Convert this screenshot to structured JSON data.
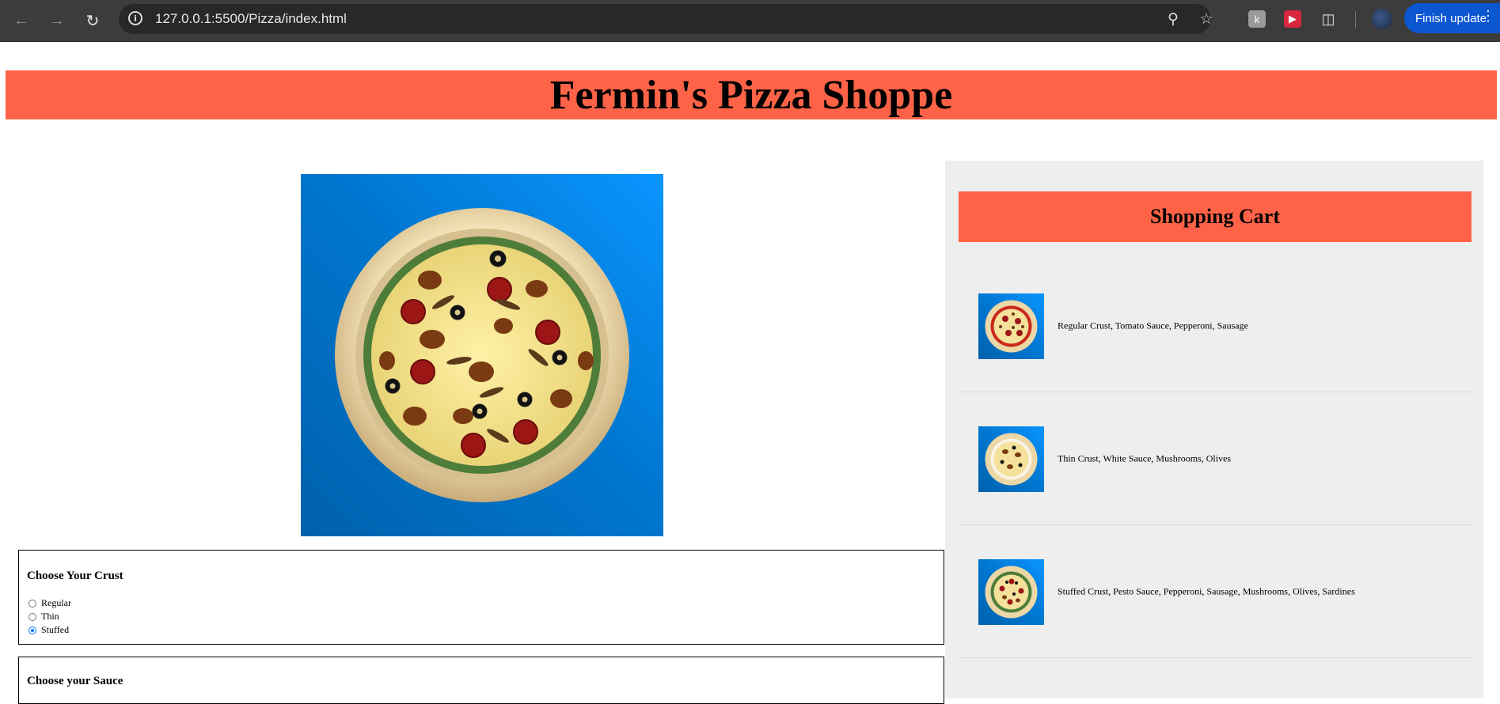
{
  "browser": {
    "url": "127.0.0.1:5500/Pizza/index.html",
    "finish_update_label": "Finish update"
  },
  "page": {
    "title": "Fermin's Pizza Shoppe"
  },
  "builder": {
    "crust_title": "Choose Your Crust",
    "crust_options": [
      {
        "label": "Regular",
        "checked": false
      },
      {
        "label": "Thin",
        "checked": false
      },
      {
        "label": "Stuffed",
        "checked": true
      }
    ],
    "sauce_title": "Choose your Sauce"
  },
  "cart": {
    "title": "Shopping Cart",
    "items": [
      {
        "description": "Regular Crust, Tomato Sauce, Pepperoni, Sausage"
      },
      {
        "description": "Thin Crust, White Sauce, Mushrooms, Olives"
      },
      {
        "description": "Stuffed Crust, Pesto Sauce, Pepperoni, Sausage, Mushrooms, Olives, Sardines"
      }
    ]
  },
  "colors": {
    "accent": "#ff6347",
    "cart_bg": "#eeeeee",
    "pizza_bg": "#0077d0"
  }
}
